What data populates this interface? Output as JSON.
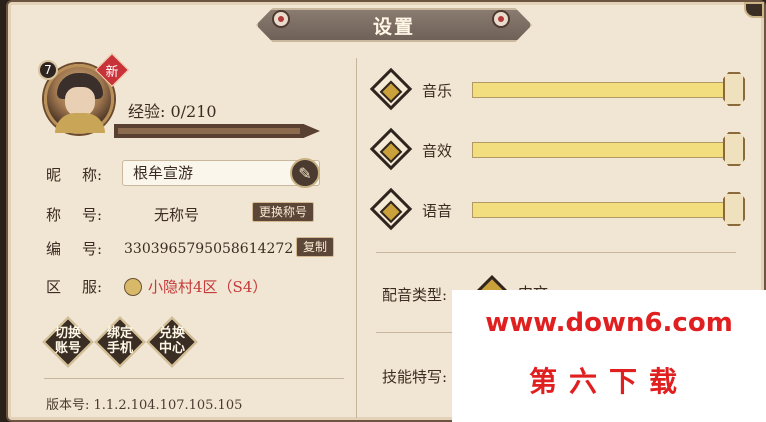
{
  "window": {
    "title": "设置"
  },
  "profile": {
    "level": "7",
    "new_badge": "新",
    "exp_label": "经验: 0/210",
    "exp_progress": 0
  },
  "fields": {
    "nickname_label": [
      "昵",
      "称:"
    ],
    "nickname_value": "根牟宣游",
    "title_label": [
      "称",
      "号:"
    ],
    "title_value": "无称号",
    "title_button": "更换称号",
    "id_label": [
      "编",
      "号:"
    ],
    "id_value": "3303965795058614272",
    "copy_button": "复制",
    "server_label": [
      "区",
      "服:"
    ],
    "server_value": "小隐村4区（S4）"
  },
  "actions": [
    {
      "label_top": "切换",
      "label_bottom": "账号"
    },
    {
      "label_top": "绑定",
      "label_bottom": "手机"
    },
    {
      "label_top": "兑换",
      "label_bottom": "中心"
    }
  ],
  "version": "版本号: 1.1.2.104.107.105.105",
  "volume": [
    {
      "label": "音乐",
      "level": 1.0
    },
    {
      "label": "音效",
      "level": 1.0
    },
    {
      "label": "语音",
      "level": 1.0
    }
  ],
  "voice_type": {
    "label": "配音类型:",
    "value": "中文"
  },
  "skill_closeup": {
    "label": "技能特写:"
  },
  "watermark": {
    "url": "www.down6.com",
    "name": "第六下载"
  },
  "colors": {
    "accent_red": "#e02020",
    "panel_bg": "#f1e6d3",
    "slider_yellow": "#f2dd7f"
  }
}
